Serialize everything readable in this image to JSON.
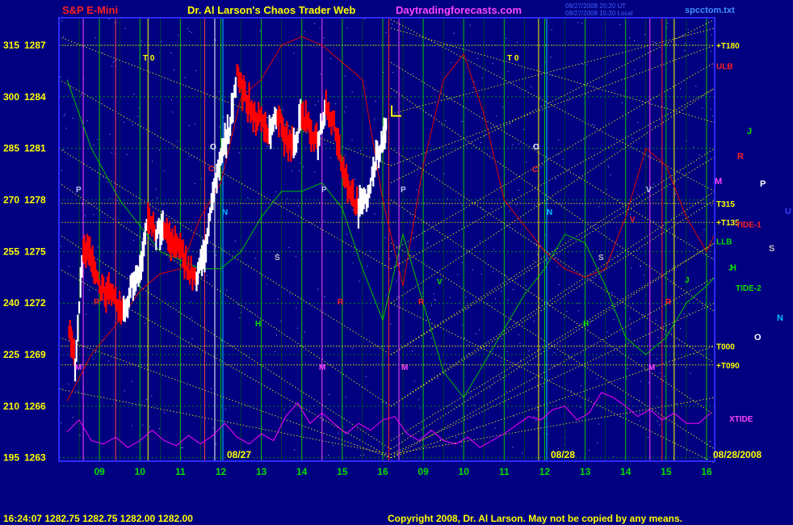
{
  "header": {
    "instrument": "S&P E-Mini",
    "title": "Dr. Al Larson's Chaos Trader Web",
    "site": "Daytradingforecasts.com",
    "stamp1": "08/27/2008 20:20 UT",
    "stamp2": "08/27/2008 15:20 Local",
    "file": "spcctom.txt"
  },
  "footer": {
    "quote": "16:24:07  1282.75 1282.75 1282.00 1282.00",
    "copyright": "Copyright 2008, Dr. Al Larson. May not be copied by any means."
  },
  "colors": {
    "background": "#000080",
    "frame": "#2a2aff",
    "hour_grid": "#00c000",
    "yellow": "#ffff00",
    "price_bar": "#ffffff",
    "down_bar": "#ff0000",
    "red_line": "#e00000",
    "green_line": "#00c000",
    "magenta": "#ff00ff"
  },
  "chart_data": {
    "type": "line",
    "title": "S&P E-Mini",
    "y_axis": {
      "degree_labels": [
        315,
        300,
        285,
        270,
        255,
        240,
        225,
        210,
        195
      ],
      "price_labels": [
        1287,
        1284,
        1281,
        1278,
        1275,
        1272,
        1269,
        1266,
        1263
      ],
      "ylim": [
        1262.8,
        1288.6
      ]
    },
    "x_axis": {
      "hour_labels": [
        "09",
        "10",
        "11",
        "12",
        "13",
        "14",
        "15",
        "16",
        "09",
        "10",
        "11",
        "12",
        "13",
        "14",
        "15",
        "16"
      ],
      "date_labels": [
        "08/27",
        "08/28",
        "08/28/2008"
      ]
    },
    "price_series": {
      "name": "S&P E-Mini price",
      "hours": [
        8.25,
        8.4,
        8.6,
        8.8,
        9.0,
        9.2,
        9.4,
        9.6,
        9.8,
        10.0,
        10.2,
        10.4,
        10.6,
        10.8,
        11.0,
        11.2,
        11.4,
        11.6,
        11.8,
        12.0,
        12.2,
        12.4,
        12.6,
        12.8,
        13.0,
        13.2,
        13.4,
        13.6,
        13.8,
        14.0,
        14.2,
        14.4,
        14.6,
        14.8,
        15.0,
        15.2,
        15.4,
        15.6,
        15.8,
        16.0,
        16.1
      ],
      "values": [
        1270.5,
        1268.5,
        1275.0,
        1274.8,
        1273.0,
        1272.6,
        1272.0,
        1271.3,
        1273.0,
        1274.0,
        1277.0,
        1276.0,
        1276.3,
        1275.5,
        1275.0,
        1274.0,
        1273.4,
        1275.0,
        1278.0,
        1280.5,
        1282.0,
        1285.5,
        1284.0,
        1283.0,
        1282.5,
        1282.0,
        1283.0,
        1281.5,
        1281.0,
        1283.0,
        1282.0,
        1281.5,
        1283.5,
        1282.5,
        1280.0,
        1278.5,
        1277.5,
        1278.0,
        1280.0,
        1281.5,
        1282.8
      ]
    },
    "red_line": {
      "hours": [
        8.2,
        8.8,
        9.5,
        10.0,
        10.5,
        11.0,
        11.5,
        12.0,
        12.5,
        13.0,
        13.5,
        14.0,
        14.5,
        15.0,
        15.5,
        16.0,
        16.5,
        17.0,
        17.5,
        18.0,
        18.5,
        19.0,
        19.5,
        20.0,
        20.5,
        21.0,
        21.5,
        22.0,
        22.5,
        23.0,
        23.5,
        24.0,
        24.2
      ],
      "values": [
        1266.3,
        1269.0,
        1271.0,
        1272.7,
        1273.7,
        1274.0,
        1277.0,
        1279.0,
        1284.0,
        1285.0,
        1287.0,
        1287.5,
        1287.0,
        1286.0,
        1285.0,
        1278.0,
        1273.0,
        1280.0,
        1285.0,
        1286.5,
        1283.0,
        1278.0,
        1276.5,
        1275.0,
        1274.0,
        1273.5,
        1274.0,
        1277.0,
        1281.0,
        1280.0,
        1277.0,
        1275.0,
        1276.0
      ]
    },
    "green_line": {
      "hours": [
        8.2,
        8.8,
        9.5,
        10.0,
        10.5,
        11.0,
        11.5,
        12.0,
        12.5,
        13.0,
        13.5,
        14.0,
        14.5,
        15.0,
        15.5,
        16.0,
        16.5,
        17.0,
        17.5,
        18.0,
        18.5,
        19.0,
        19.5,
        20.0,
        20.5,
        21.0,
        21.5,
        22.0,
        22.5,
        23.0,
        23.5,
        24.0,
        24.2
      ],
      "values": [
        1285.0,
        1281.0,
        1278.0,
        1276.5,
        1275.0,
        1274.5,
        1274.0,
        1274.0,
        1275.0,
        1277.0,
        1278.5,
        1278.5,
        1279.0,
        1277.5,
        1274.0,
        1271.0,
        1276.0,
        1272.0,
        1268.0,
        1266.5,
        1268.5,
        1270.5,
        1272.5,
        1274.0,
        1276.0,
        1275.5,
        1273.0,
        1270.0,
        1269.0,
        1270.0,
        1272.0,
        1273.0,
        1273.5
      ]
    },
    "xtide": {
      "name": "XTIDE",
      "hours": [
        8.2,
        8.5,
        8.8,
        9.1,
        9.4,
        9.7,
        10.0,
        10.3,
        10.6,
        10.9,
        11.2,
        11.5,
        11.8,
        12.1,
        12.4,
        12.7,
        13.0,
        13.3,
        13.6,
        13.9,
        14.2,
        14.5,
        14.8,
        15.1,
        15.4,
        15.7,
        16.0,
        16.3,
        16.6,
        16.9,
        17.2,
        17.5,
        17.8,
        18.1,
        18.4,
        18.7,
        19.0,
        19.3,
        19.6,
        19.9,
        20.2,
        20.5,
        20.8,
        21.1,
        21.4,
        21.7,
        22.0,
        22.3,
        22.6,
        22.9,
        23.2,
        23.5,
        23.8,
        24.1
      ],
      "values": [
        1264.5,
        1265.2,
        1264.0,
        1263.8,
        1264.2,
        1263.6,
        1264.0,
        1264.6,
        1264.0,
        1263.7,
        1264.3,
        1263.8,
        1264.3,
        1265.0,
        1264.2,
        1263.8,
        1264.4,
        1264.0,
        1265.4,
        1266.2,
        1265.0,
        1265.6,
        1265.0,
        1264.4,
        1265.0,
        1264.6,
        1265.2,
        1265.4,
        1264.4,
        1264.0,
        1264.6,
        1264.0,
        1263.8,
        1264.2,
        1263.6,
        1264.0,
        1264.4,
        1264.9,
        1265.4,
        1265.2,
        1265.8,
        1266.0,
        1265.2,
        1265.6,
        1266.8,
        1266.5,
        1266.0,
        1265.4,
        1265.8,
        1265.2,
        1265.6,
        1265.0,
        1265.0,
        1265.6
      ]
    },
    "right_labels": [
      {
        "text": "+T180",
        "value": 1287.0,
        "color": "#ffff00"
      },
      {
        "text": "ULB",
        "value": 1285.8,
        "color": "#ff2020"
      },
      {
        "text": "T315",
        "value": 1277.8,
        "color": "#ffff00"
      },
      {
        "text": "+T135",
        "value": 1276.7,
        "color": "#ffff00"
      },
      {
        "text": "LLB",
        "value": 1275.6,
        "color": "#00e000"
      },
      {
        "text": "T000",
        "value": 1269.5,
        "color": "#ffff00"
      },
      {
        "text": "+T090",
        "value": 1268.4,
        "color": "#ffff00"
      },
      {
        "text": "XTIDE",
        "value": 1265.3,
        "color": "#ff44ff"
      },
      {
        "text": "TIDE-1",
        "value": 1276.6,
        "color": "#ff2020"
      },
      {
        "text": "TIDE-2",
        "value": 1272.9,
        "color": "#00e000"
      }
    ],
    "planet_markers": [
      {
        "t": "J",
        "color": "#00e000"
      },
      {
        "t": "R",
        "color": "#ff2020"
      },
      {
        "t": "M",
        "color": "#ff44ff"
      },
      {
        "t": "P",
        "color": "#ffffff"
      },
      {
        "t": "U",
        "color": "#4040ff"
      },
      {
        "t": "S",
        "color": "#c0c0c0"
      },
      {
        "t": "H",
        "color": "#00e000"
      },
      {
        "t": "N",
        "color": "#00c0ff"
      },
      {
        "t": "O",
        "color": "#ffffff"
      }
    ],
    "chart_letters": [
      {
        "t": "T 0",
        "color": "#ffff00"
      },
      {
        "t": "T 0",
        "color": "#ffff00"
      },
      {
        "t": "O",
        "color": "#ffffff"
      },
      {
        "t": "O",
        "color": "#ffffff"
      },
      {
        "t": "C",
        "color": "#ff2020"
      },
      {
        "t": "C",
        "color": "#ff2020"
      },
      {
        "t": "P",
        "color": "#c0c0ff"
      },
      {
        "t": "P",
        "color": "#c0c0ff"
      },
      {
        "t": "P",
        "color": "#c0c0ff"
      },
      {
        "t": "N",
        "color": "#00c0ff"
      },
      {
        "t": "N",
        "color": "#00c0ff"
      },
      {
        "t": "S",
        "color": "#c0c0c0"
      },
      {
        "t": "S",
        "color": "#c0c0c0"
      },
      {
        "t": "R",
        "color": "#ff2020"
      },
      {
        "t": "R",
        "color": "#ff2020"
      },
      {
        "t": "R",
        "color": "#ff2020"
      },
      {
        "t": "R",
        "color": "#ff2020"
      },
      {
        "t": "H",
        "color": "#00e000"
      },
      {
        "t": "H",
        "color": "#00e000"
      },
      {
        "t": "M",
        "color": "#ff44ff"
      },
      {
        "t": "M",
        "color": "#ff44ff"
      },
      {
        "t": "M",
        "color": "#ff44ff"
      },
      {
        "t": "M",
        "color": "#ff44ff"
      },
      {
        "t": "V",
        "color": "#00e000"
      },
      {
        "t": "V",
        "color": "#ff2020"
      },
      {
        "t": "V",
        "color": "#c0c0ff"
      },
      {
        "t": "J",
        "color": "#00e000"
      },
      {
        "t": "J",
        "color": "#00e000"
      }
    ]
  }
}
